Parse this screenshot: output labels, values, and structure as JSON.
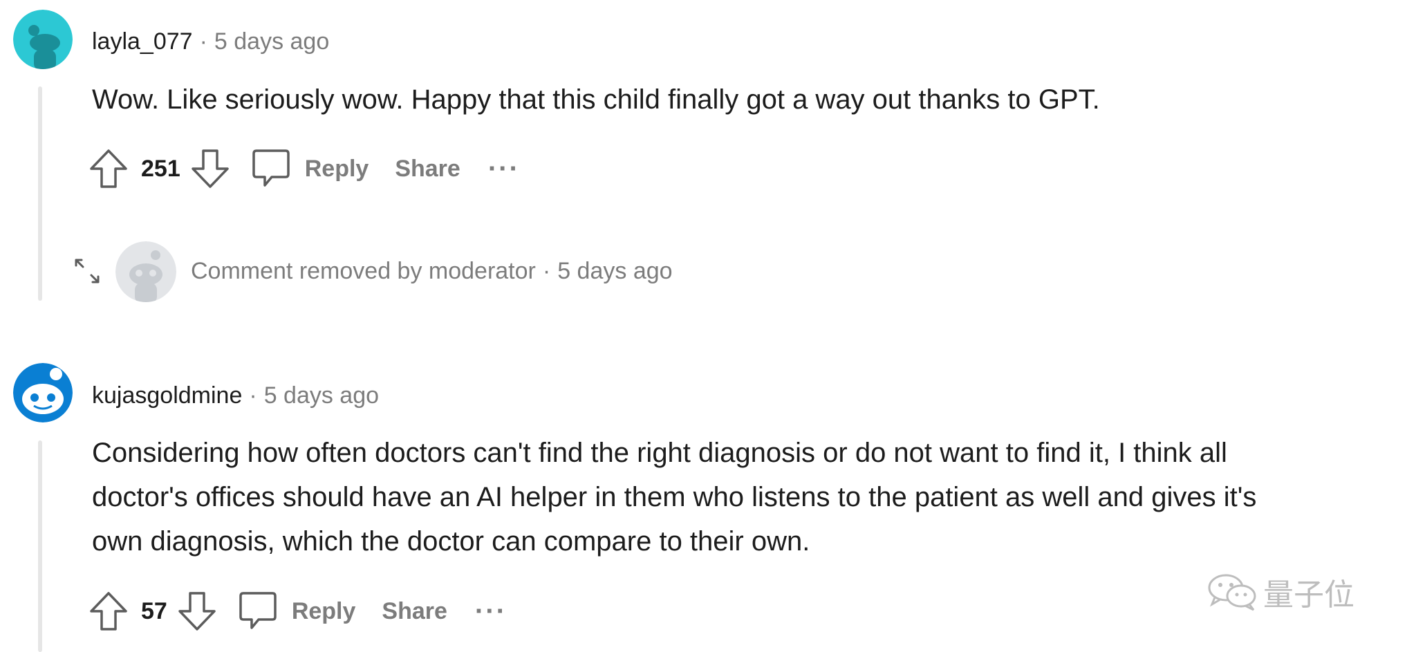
{
  "comments": [
    {
      "username": "layla_077",
      "separator": "·",
      "time": "5 days ago",
      "body_lines": [
        "Wow. Like seriously wow. Happy that this child finally got a way out thanks to GPT."
      ],
      "votes": "251",
      "reply_label": "Reply",
      "share_label": "Share",
      "more_label": "···",
      "avatar_color": "#2cc8d4"
    },
    {
      "username": "kujasgoldmine",
      "separator": "·",
      "time": "5 days ago",
      "body_lines": [
        "Considering how often doctors can't find the right diagnosis or do not want to find it, I think all",
        "doctor's offices should have an AI helper in them who listens to the patient as well and gives it's",
        "own diagnosis, which the doctor can compare to their own."
      ],
      "votes": "57",
      "reply_label": "Reply",
      "share_label": "Share",
      "more_label": "···",
      "avatar_color": "#0a7fd3"
    }
  ],
  "removed_comment": {
    "text": "Comment removed by moderator",
    "separator": "·",
    "time": "5 days ago"
  },
  "watermark": {
    "text": "量子位"
  }
}
